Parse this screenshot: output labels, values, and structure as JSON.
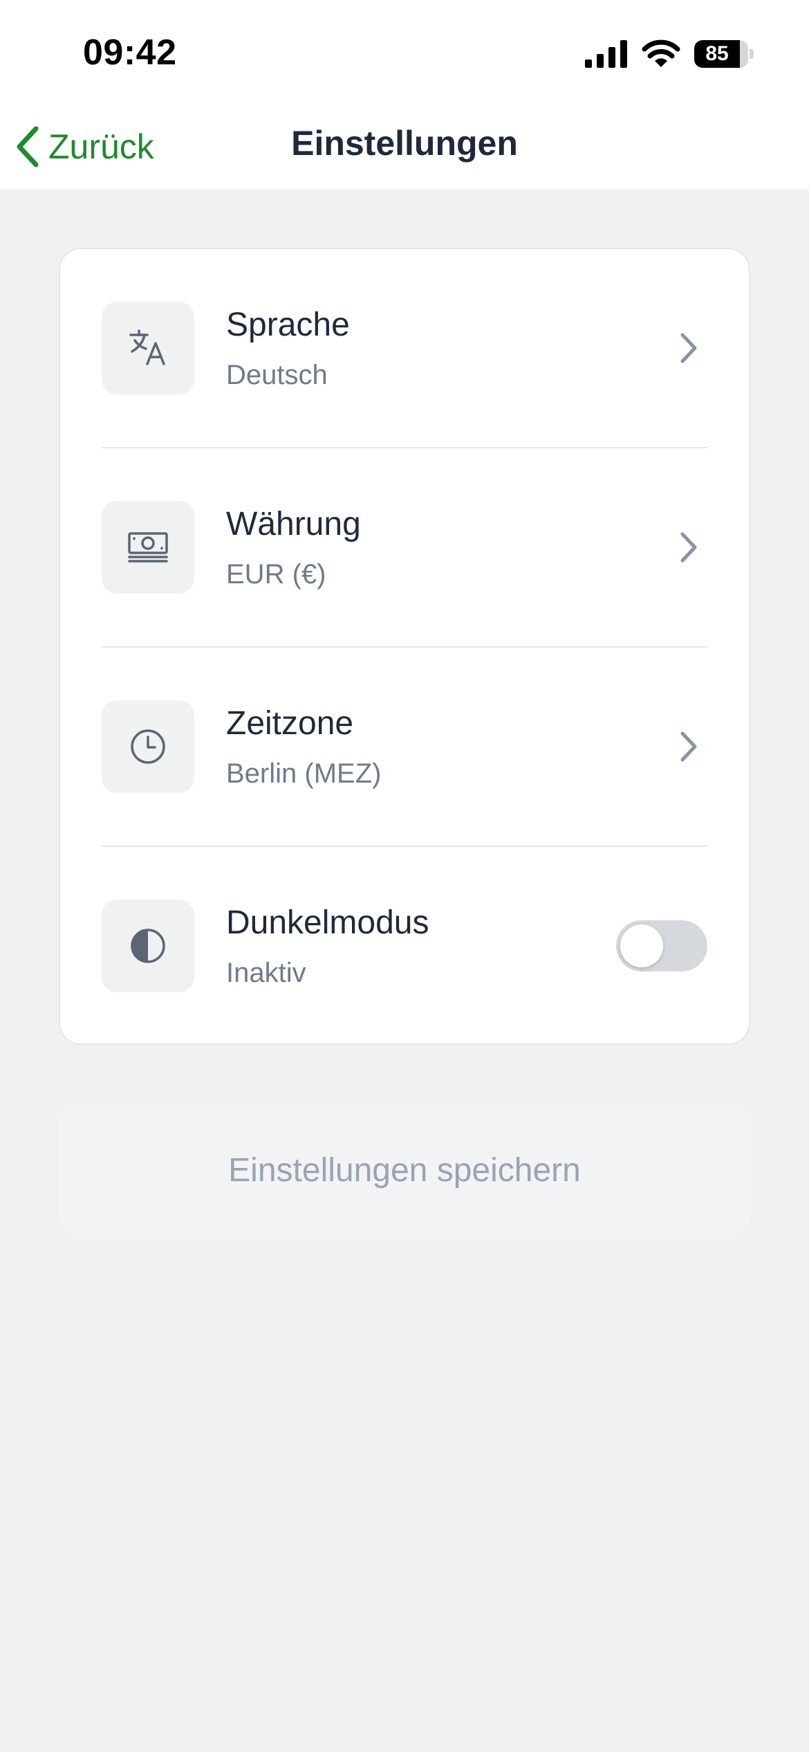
{
  "status_bar": {
    "time": "09:42",
    "battery_level": "85"
  },
  "nav": {
    "back_label": "Zurück",
    "title": "Einstellungen"
  },
  "settings": {
    "items": [
      {
        "title": "Sprache",
        "value": "Deutsch",
        "icon": "translate-icon"
      },
      {
        "title": "Währung",
        "value": "EUR (€)",
        "icon": "banknote-icon"
      },
      {
        "title": "Zeitzone",
        "value": "Berlin (MEZ)",
        "icon": "clock-icon"
      },
      {
        "title": "Dunkelmodus",
        "value": "Inaktiv",
        "icon": "contrast-icon",
        "toggle_on": false
      }
    ]
  },
  "save_button": {
    "label": "Einstellungen speichern",
    "enabled": false
  },
  "colors": {
    "accent": "#1f8a2c",
    "background": "#eff2f1",
    "title_text": "#1e293b",
    "secondary_text": "#707a8c",
    "icon": "#5c6475",
    "disabled_text": "#9aa3b2"
  }
}
